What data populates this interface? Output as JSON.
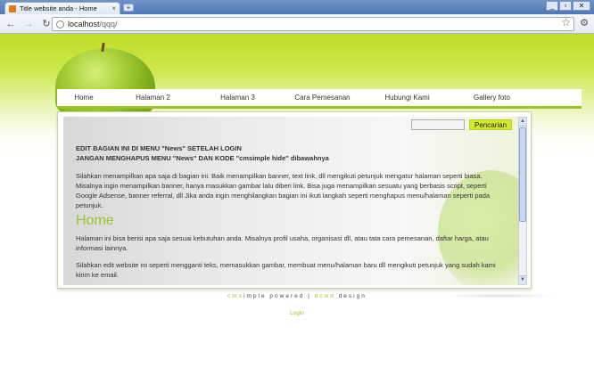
{
  "browser": {
    "tab_title": "Title website anda - Home",
    "tab_close": "×",
    "new_tab": "+",
    "window_buttons": [
      "_",
      "▫",
      "✕"
    ],
    "back": "←",
    "forward": "→",
    "reload": "↻",
    "url_host": "localhost",
    "url_path": "/qqq/",
    "star": "☆",
    "wrench": "🔧"
  },
  "nav": {
    "items": [
      {
        "label": "Home"
      },
      {
        "label": "Halaman 2"
      },
      {
        "label": "Halaman 3"
      },
      {
        "label": "Cara Pemesanan"
      },
      {
        "label": "Hubungi Kami"
      },
      {
        "label": "Gallery foto"
      }
    ]
  },
  "search": {
    "input_value": "",
    "button_label": "Pencarian"
  },
  "content": {
    "notice_line1": "EDIT BAGIAN INI DI MENU \"News\" SETELAH LOGIN",
    "notice_line2": "JANGAN MENGHAPUS MENU \"News\" DAN KODE \"cmsimple hide\" dibawahnya",
    "intro": "Silahkan menampilkan apa saja di bagian ini. Baik menampilkan banner, text link, dll mengikuti petunjuk mengatur halaman seperti biasa. Misalnya ingin menampilkan banner, hanya masukkan gambar lalu diberi link. Bisa juga menampilkan sesuatu yang berbasis script, seperti Google Adsense, banner referral, dll Jika anda ingin menghilangkan bagian ini ikuti langkah seperti menghapus menu/halaman seperti pada petunjuk.",
    "heading": "Home",
    "para1": "Halaman ini bisa berisi apa saja sesuai kebutuhan anda. Misalnya profil usaha, organisasi dll, atau tata cara pemesanan, daftar harga, atau informasi lainnya.",
    "para2": "Silahkan edit website ini seperti mengganti teks, memasukkan gambar, membuat menu/halaman baru dll mengikuti petunjuk yang sudah kami kirim ke email."
  },
  "footer": {
    "cms_green": "cms",
    "cms_rest": "imple powered",
    "separator": "|",
    "dcwd_green": "dcwd",
    "design": "design",
    "login": "Login"
  },
  "colors": {
    "accent_green": "#9cc22a",
    "button_yellow": "#d3ea2c"
  }
}
